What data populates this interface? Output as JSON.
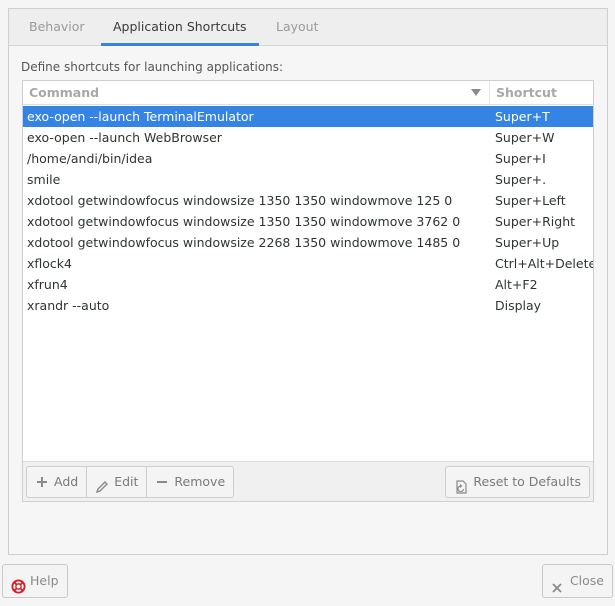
{
  "tabs": [
    {
      "label": "Behavior",
      "active": false
    },
    {
      "label": "Application Shortcuts",
      "active": true
    },
    {
      "label": "Layout",
      "active": false
    }
  ],
  "description": "Define shortcuts for launching applications:",
  "table": {
    "columns": [
      "Command",
      "Shortcut"
    ],
    "rows": [
      {
        "command": "exo-open --launch TerminalEmulator",
        "shortcut": "Super+T",
        "selected": true
      },
      {
        "command": "exo-open --launch WebBrowser",
        "shortcut": "Super+W"
      },
      {
        "command": "/home/andi/bin/idea",
        "shortcut": "Super+I"
      },
      {
        "command": "smile",
        "shortcut": "Super+."
      },
      {
        "command": "xdotool getwindowfocus windowsize 1350 1350 windowmove 125 0",
        "shortcut": "Super+Left"
      },
      {
        "command": "xdotool getwindowfocus windowsize 1350 1350 windowmove 3762 0",
        "shortcut": "Super+Right"
      },
      {
        "command": "xdotool getwindowfocus windowsize 2268 1350 windowmove 1485 0",
        "shortcut": "Super+Up"
      },
      {
        "command": "xflock4",
        "shortcut": "Ctrl+Alt+Delete"
      },
      {
        "command": "xfrun4",
        "shortcut": "Alt+F2"
      },
      {
        "command": "xrandr --auto",
        "shortcut": "Display"
      }
    ]
  },
  "toolbar": {
    "add_label": "Add",
    "edit_label": "Edit",
    "remove_label": "Remove",
    "reset_label": "Reset to Defaults"
  },
  "dialog": {
    "help_label": "Help",
    "close_label": "Close"
  },
  "colors": {
    "accent": "#3584e4",
    "help_icon": "#e01b24"
  },
  "icons": {
    "add": "plus-icon",
    "edit": "pencil-icon",
    "remove": "minus-icon",
    "reset": "revert-document-icon",
    "help": "lifebuoy-icon",
    "close": "close-x-icon",
    "sort": "sort-descending-arrow-icon"
  }
}
